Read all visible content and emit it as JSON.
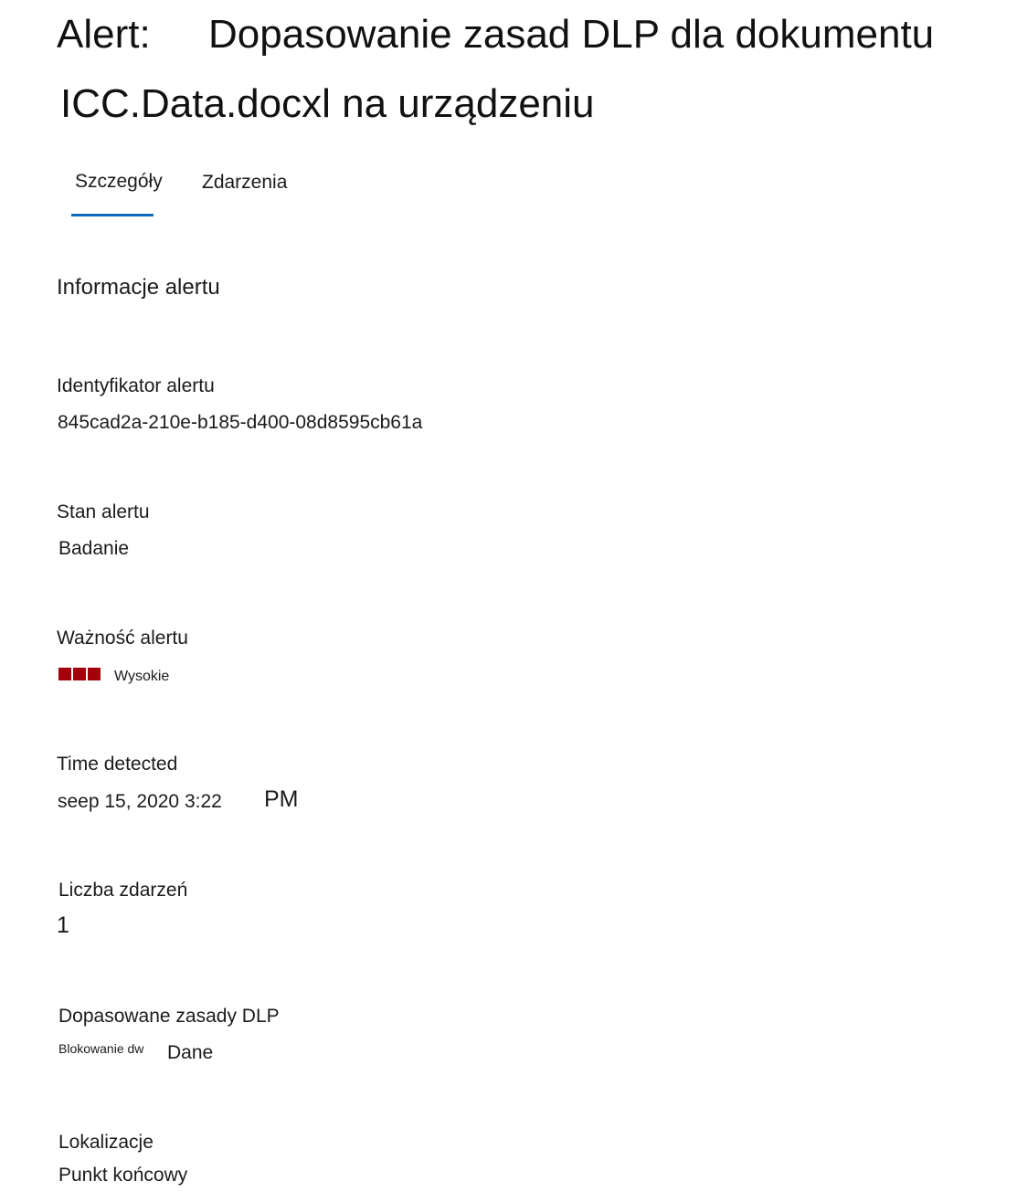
{
  "header": {
    "title_prefix": "Alert:",
    "title_line1": "Dopasowanie zasad DLP dla dokumentu",
    "title_line2": "ICC.Data.docxl na urządzeniu"
  },
  "tabs": [
    {
      "label": "Szczegóły",
      "active": true
    },
    {
      "label": "Zdarzenia",
      "active": false
    }
  ],
  "section": {
    "heading": "Informacje alertu"
  },
  "fields": {
    "alert_id": {
      "label": "Identyfikator alertu",
      "value": "845cad2a-210e-b185-d400-08d8595cb61a"
    },
    "alert_status": {
      "label": "Stan alertu",
      "value": "Badanie"
    },
    "alert_severity": {
      "label": "Ważność alertu",
      "value": "Wysokie",
      "color": "#a4000c",
      "level": 3
    },
    "time_detected": {
      "label": "Time detected",
      "value": "seep 15, 2020 3:22",
      "ampm": "PM"
    },
    "event_count": {
      "label": "Liczba zdarzeń",
      "value": "1"
    },
    "matched_policy": {
      "label": "Dopasowane zasady DLP",
      "value_part1": "Blokowanie dw",
      "value_part2": "Dane"
    },
    "locations": {
      "label": "Lokalizacje",
      "value": "Punkt końcowy"
    }
  },
  "colors": {
    "accent": "#0f6cbd",
    "severity_high": "#a4000c"
  }
}
